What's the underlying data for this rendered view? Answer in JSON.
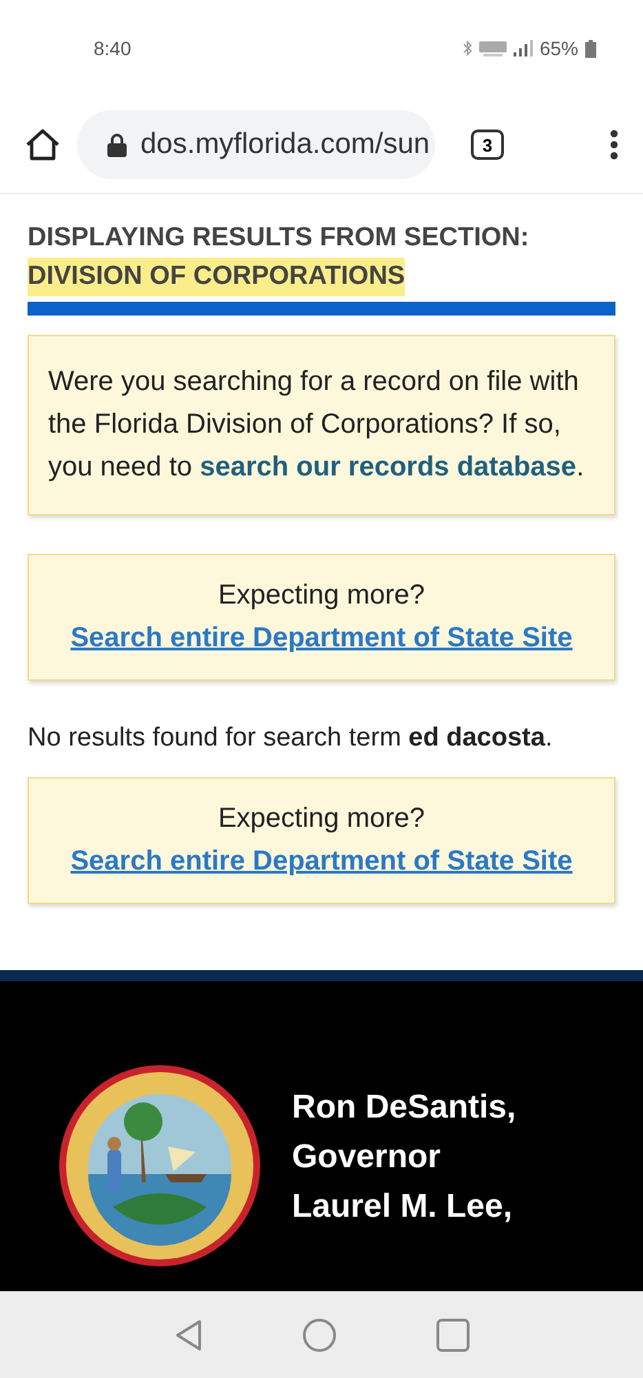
{
  "status_bar": {
    "time": "8:40",
    "battery": "65%"
  },
  "browser": {
    "url": "dos.myflorida.com/sun",
    "tab_count": "3"
  },
  "section_heading": {
    "label": "DISPLAYING RESULTS FROM SECTION:",
    "highlight": "DIVISION OF CORPORATIONS"
  },
  "results": [
    {
      "kind": "notice",
      "text": "Were you searching for a record on file with the Florida Division of Corporations? If so, you need to ",
      "link": "search our records database",
      "after": "."
    },
    {
      "kind": "expect",
      "text": "Expecting more?",
      "link": "Search entire Department of State Site"
    },
    {
      "kind": "message",
      "text": "No results found for search term **ed dacosta**."
    },
    {
      "kind": "expect",
      "text": "Expecting more?",
      "link": "Search entire Department of State Site"
    }
  ],
  "footer": {
    "lines": [
      "Ron DeSantis,",
      "Governor",
      "Laurel M. Lee,"
    ]
  }
}
